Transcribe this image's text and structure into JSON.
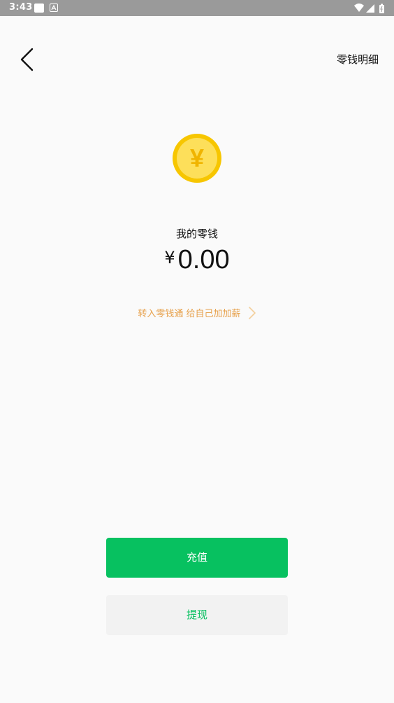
{
  "status_bar": {
    "time": "3:43",
    "icons": [
      "app-notification-icon",
      "app-a-icon",
      "wifi-icon",
      "signal-icon",
      "battery-icon"
    ]
  },
  "nav": {
    "back_icon": "chevron-left-icon",
    "details_label": "零钱明细"
  },
  "balance": {
    "coin_icon": "yen-coin-icon",
    "coin_glyph": "¥",
    "label": "我的零钱",
    "currency": "¥",
    "amount": "0.00"
  },
  "promo": {
    "text": "转入零钱通 给自己加加薪",
    "arrow_icon": "chevron-right-icon"
  },
  "actions": {
    "recharge_label": "充值",
    "withdraw_label": "提现"
  },
  "colors": {
    "primary_green": "#07c160",
    "promo_orange": "#e7a04a",
    "coin_gold": "#f7c600",
    "coin_inner": "#fddf5a",
    "status_bar_bg": "#9a9a9a",
    "page_bg": "#fafafa"
  }
}
